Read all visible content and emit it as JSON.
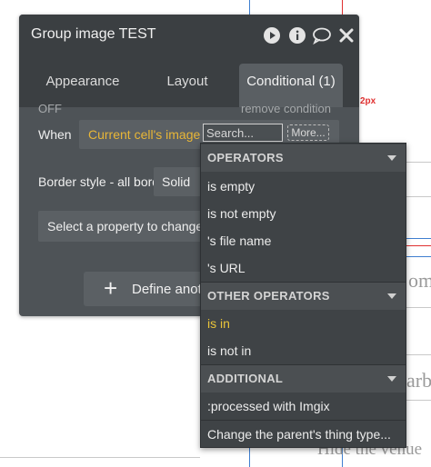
{
  "panel": {
    "title": "Group image TEST",
    "tabs": [
      {
        "label": "Appearance",
        "active": false
      },
      {
        "label": "Layout",
        "active": false
      },
      {
        "label": "Conditional (1)",
        "active": true
      }
    ],
    "condition": {
      "state_label": "OFF",
      "remove_label": "remove condition",
      "when_label": "When",
      "expression": "Current cell's image",
      "search_placeholder": "Search...",
      "more_label": "More..."
    },
    "property_row": {
      "label": "Border style - all borders",
      "value": "Solid"
    },
    "property_select": "Select a property to change",
    "define_button": {
      "icon": "+",
      "label": "Define another condition"
    }
  },
  "canvas": {
    "size_label": "2px",
    "side_text_1": "om",
    "side_text_2": "arbo",
    "side_text_3": "Hide the venue"
  },
  "dropdown": {
    "sections": [
      {
        "header": "OPERATORS",
        "items": [
          "is empty",
          "is not empty",
          "'s file name",
          "'s URL"
        ]
      },
      {
        "header": "OTHER OPERATORS",
        "items": [
          "is in",
          "is not in"
        ]
      },
      {
        "header": "ADDITIONAL",
        "items": [
          ":processed with Imgix",
          "Change the parent's thing type..."
        ]
      }
    ]
  },
  "colors": {
    "panel_bg": "#4e5357",
    "titlebar_bg": "#3b3f42",
    "expression_color": "#e8b637",
    "highlight_item": "#e8c43a",
    "canvas_red": "#e03030",
    "canvas_blue": "#3f7fd0"
  },
  "icons": [
    "play-icon",
    "info-icon",
    "comment-icon",
    "close-icon",
    "plus-icon",
    "chevron-down-icon"
  ]
}
